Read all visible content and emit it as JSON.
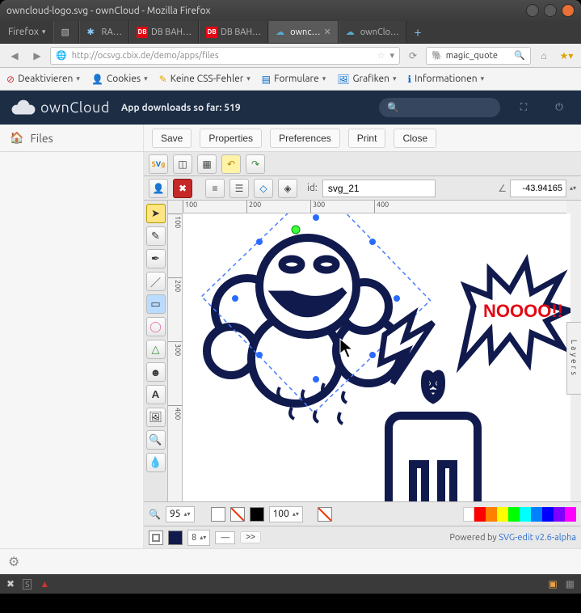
{
  "window": {
    "title": "owncloud-logo.svg - ownCloud - Mozilla Firefox"
  },
  "firefox": {
    "menu": "Firefox",
    "tabs": [
      {
        "label": "",
        "active": false
      },
      {
        "label": "RA…",
        "active": false
      },
      {
        "label": "DB BAH…",
        "active": false,
        "fav": "db"
      },
      {
        "label": "DB BAH…",
        "active": false,
        "fav": "db"
      },
      {
        "label": "ownc…",
        "active": true,
        "fav": "oc"
      },
      {
        "label": "ownClo…",
        "active": false,
        "fav": "oc"
      }
    ],
    "url": "http://ocsvg.cbix.de/demo/apps/files",
    "search": {
      "engine": "php",
      "query": "magic_quote"
    }
  },
  "fx_toolbar": {
    "items": [
      "Deaktivieren",
      "Cookies",
      "Keine CSS-Fehler",
      "Formulare",
      "Grafiken",
      "Informationen"
    ]
  },
  "owncloud": {
    "brand": "ownCloud",
    "downloads_label": "App downloads so far: 519",
    "side_header": "Files",
    "sub_buttons": [
      "Save",
      "Properties",
      "Preferences",
      "Print",
      "Close"
    ]
  },
  "editor": {
    "id_label": "id:",
    "id_value": "svg_21",
    "angle": "-43.94165",
    "ruler_h": [
      "100",
      "200",
      "300",
      "400"
    ],
    "ruler_v": [
      "100",
      "200",
      "300",
      "400"
    ],
    "layers": "Layers",
    "zoom": "95",
    "opacity": "100",
    "stroke_width": "8",
    "more": ">>",
    "powered": "Powered by ",
    "powered_link": "SVG-edit v2.6-alpha",
    "artwork": {
      "speech": "NOOOO!!"
    },
    "swatches": [
      "#ffffff",
      "#ff0000",
      "#ff8000",
      "#ffff00",
      "#00ff00",
      "#00ffff",
      "#0080ff",
      "#0000ff",
      "#8000ff",
      "#ff00ff"
    ]
  }
}
